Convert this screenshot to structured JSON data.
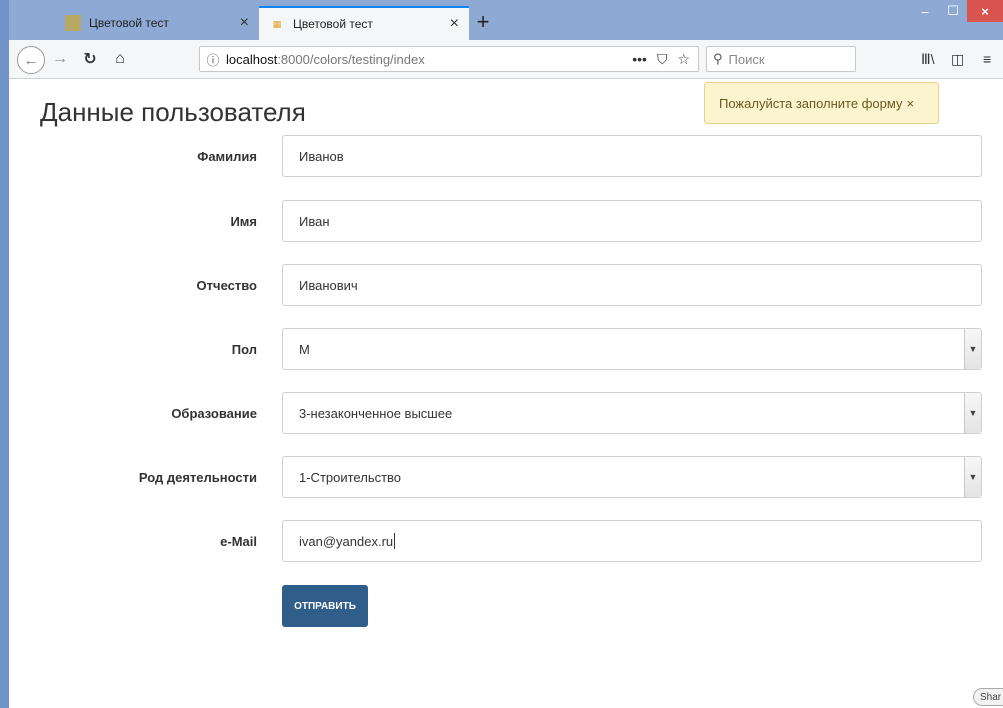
{
  "browser": {
    "tabs": [
      {
        "title": "Цветовой тест",
        "active": false
      },
      {
        "title": "Цветовой тест",
        "active": true
      }
    ],
    "new_tab_label": "+",
    "url_host": "localhost",
    "url_path": ":8000/colors/testing/index",
    "search_placeholder": "Поиск",
    "window_controls": {
      "minimize": "–",
      "maximize": "☐",
      "close": "×"
    }
  },
  "page": {
    "title": "Данные пользователя",
    "alert": {
      "text": "Пожалуйста заполните форму",
      "close": "×"
    },
    "form": {
      "fields": [
        {
          "label": "Фамилия",
          "value": "Иванов",
          "type": "text"
        },
        {
          "label": "Имя",
          "value": "Иван",
          "type": "text"
        },
        {
          "label": "Отчество",
          "value": "Иванович",
          "type": "text"
        },
        {
          "label": "Пол",
          "value": "М",
          "type": "select"
        },
        {
          "label": "Образование",
          "value": "3-незаконченное высшее",
          "type": "select"
        },
        {
          "label": "Род деятельности",
          "value": "1-Строительство",
          "type": "select"
        },
        {
          "label": "e-Mail",
          "value": "ivan@yandex.ru",
          "type": "email"
        }
      ],
      "submit_label": "ОТПРАВИТЬ"
    },
    "share_label": "Shar"
  },
  "colors": {
    "accent": "#0a84ff",
    "submit_button": "#2f5e8b",
    "alert_bg": "#fcf3cf",
    "tabbar_bg": "#8ea9d3"
  }
}
